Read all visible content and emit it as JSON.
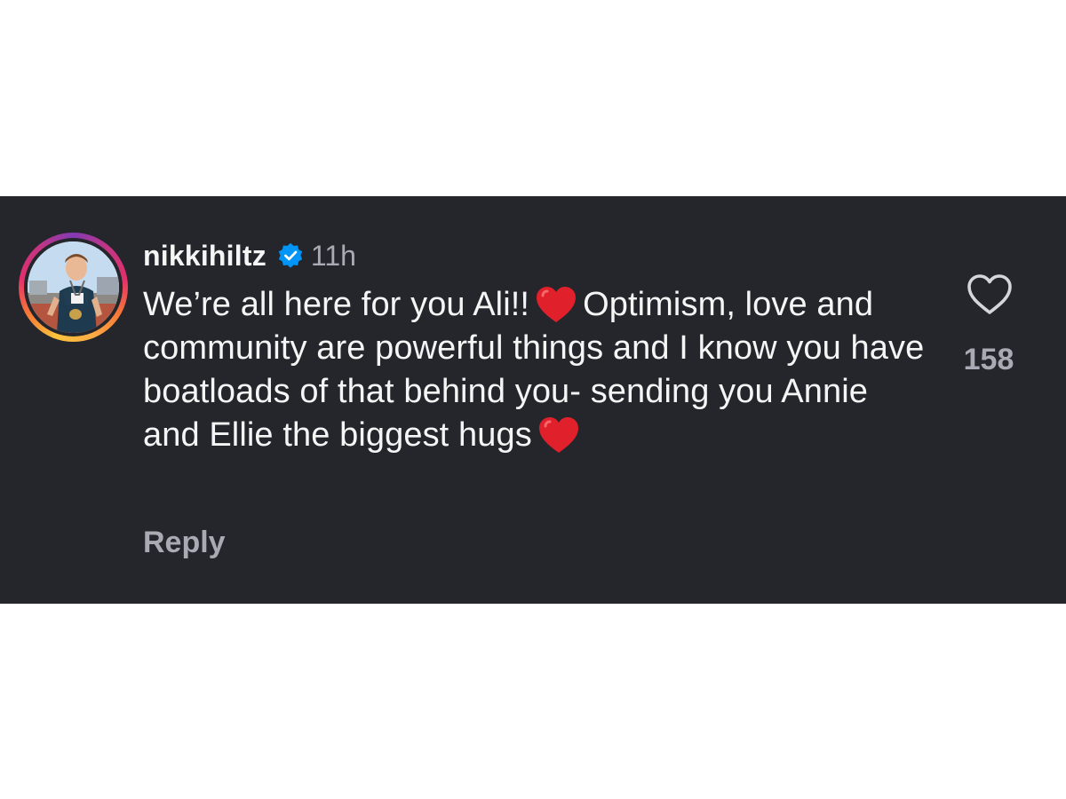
{
  "comment": {
    "username": "nikkihiltz",
    "verified": true,
    "timestamp": "11h",
    "text_parts": [
      "We’re all here for you Ali!!",
      "Optimism, love and community are powerful things and I know you have boatloads of that behind you- sending you Annie and Ellie the biggest hugs"
    ],
    "emoji": "red-heart",
    "reply_label": "Reply",
    "like_count": "158"
  },
  "icons": {
    "verified": "verified-badge-icon",
    "like": "heart-outline-icon",
    "emoji": "red-heart-emoji"
  },
  "colors": {
    "card_background": "#24262c",
    "text_primary": "#f5f5f5",
    "text_secondary": "#a8abb3",
    "verified_blue": "#0095f6",
    "heart_red": "#e0202b"
  }
}
